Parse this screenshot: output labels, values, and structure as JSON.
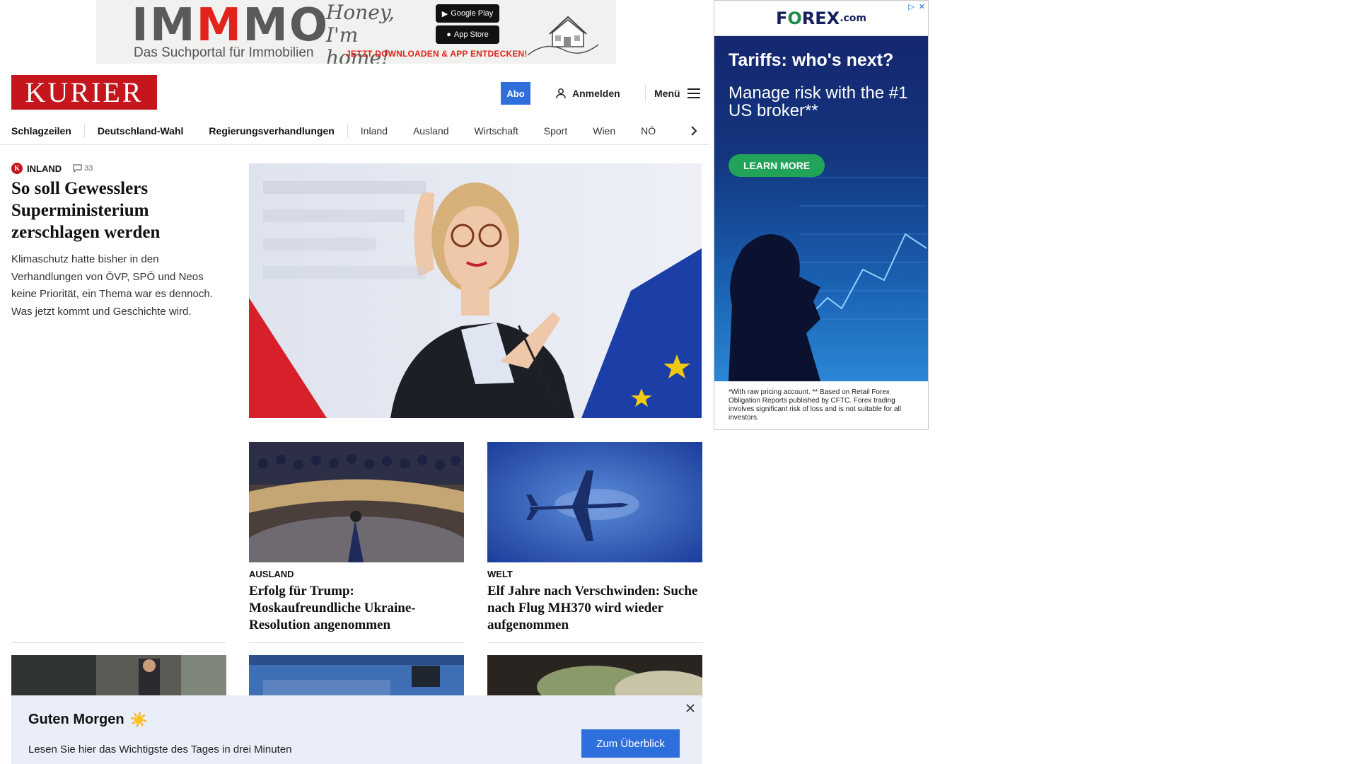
{
  "top_ad": {
    "brand_pre": "IM",
    "brand_red": "M",
    "brand_post": "MO",
    "tagline": "Das Suchportal für Immobilien",
    "script": "Honey, I'm home!",
    "google_play": "Google Play",
    "app_store": "App Store",
    "cta": "JETZT DOWNLOADEN & APP ENTDECKEN!"
  },
  "header": {
    "logo": "KURIER",
    "abo": "Abo",
    "login": "Anmelden",
    "menu": "Menü"
  },
  "nav": {
    "items": [
      "Schlagzeilen",
      "Deutschland-Wahl",
      "Regierungsverhandlungen",
      "Inland",
      "Ausland",
      "Wirtschaft",
      "Sport",
      "Wien",
      "NÖ"
    ]
  },
  "lead": {
    "badge": "K",
    "kicker": "INLAND",
    "comments": "33",
    "title": "So soll Gewesslers Superministerium zerschlagen werden",
    "text": "Klimaschutz hatte bisher in den Verhandlungen von ÖVP, SPÖ und Neos keine Priorität, ein Thema war es dennoch. Was jetzt kommt und Geschichte wird."
  },
  "teasers": [
    {
      "kicker": "AUSLAND",
      "title": "Erfolg für Trump: Moskaufreundliche Ukraine-Resolution angenommen"
    },
    {
      "kicker": "WELT",
      "title": "Elf Jahre nach Verschwinden: Suche nach Flug MH370 wird wieder aufgenommen"
    }
  ],
  "side_ad": {
    "brand_pre": "F",
    "brand_o": "O",
    "brand_post": "REX",
    "brand_tld": ".com",
    "headline": "Tariffs: who's next?",
    "sub": "Manage risk with the #1 US broker**",
    "cta": "LEARN MORE",
    "disclaimer": "*With raw pricing account. ** Based on Retail Forex Obligation Reports published by CFTC. Forex trading involves significant risk of loss and is not suitable for all investors."
  },
  "notification": {
    "title": "Guten Morgen",
    "emoji": "☀️",
    "text": "Lesen Sie hier das Wichtigste des Tages in drei Minuten",
    "button": "Zum Überblick"
  },
  "colors": {
    "brand_red": "#c4161c",
    "accent_blue": "#2f6fdc",
    "notif_bg": "#e9eef8"
  }
}
